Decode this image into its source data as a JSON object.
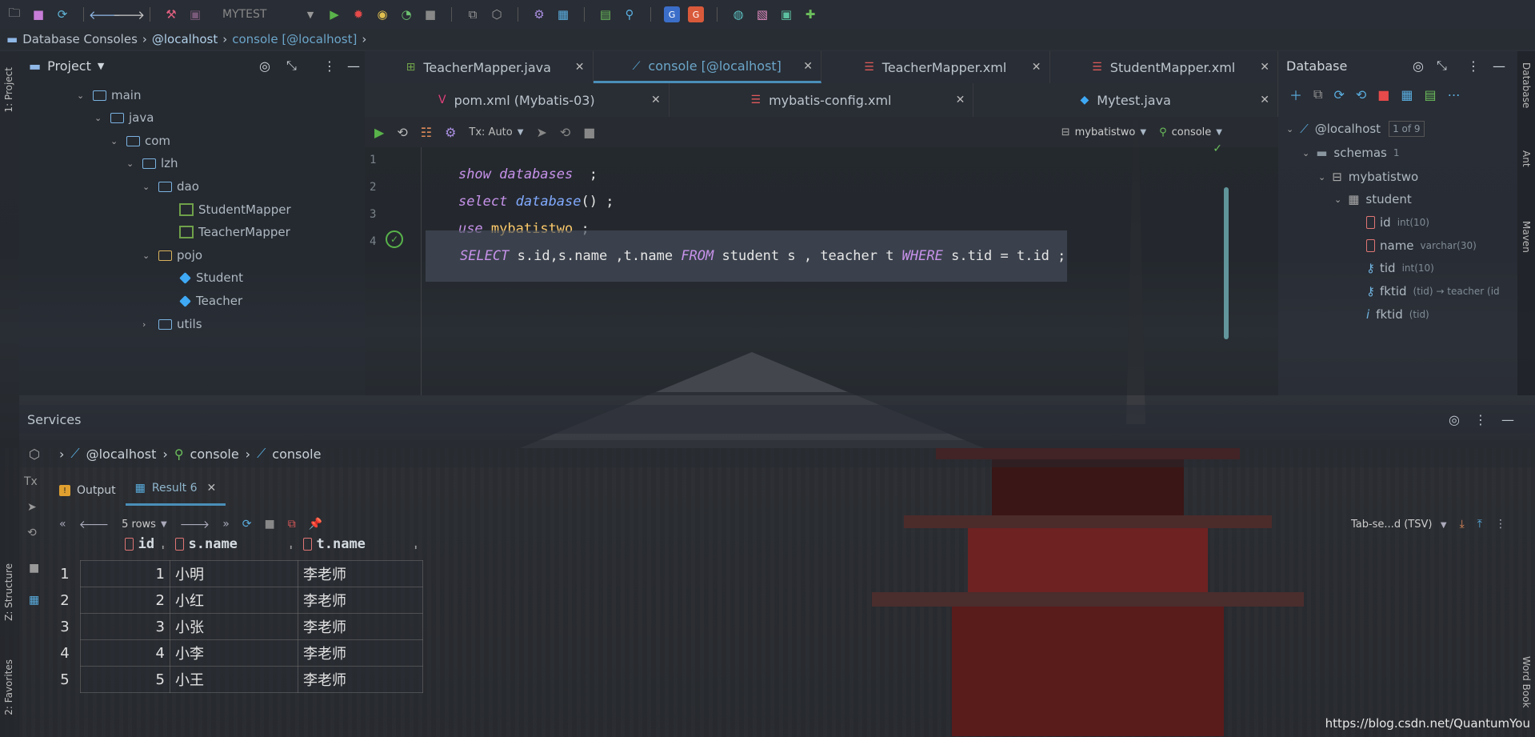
{
  "toolbar": {
    "run_config": "MYTEST"
  },
  "breadcrumb": {
    "root": "Database Consoles",
    "host": "@localhost",
    "console": "console [@localhost]"
  },
  "left_strip": {
    "project": "1: Project",
    "structure": "Z: Structure",
    "favorites": "2: Favorites"
  },
  "project": {
    "title": "Project",
    "tree": [
      {
        "label": "main"
      },
      {
        "label": "java"
      },
      {
        "label": "com"
      },
      {
        "label": "lzh"
      },
      {
        "label": "dao"
      },
      {
        "label": "StudentMapper"
      },
      {
        "label": "TeacherMapper"
      },
      {
        "label": "pojo"
      },
      {
        "label": "Student"
      },
      {
        "label": "Teacher"
      },
      {
        "label": "utils"
      }
    ]
  },
  "editor": {
    "tabs_row1": [
      {
        "label": "TeacherMapper.java"
      },
      {
        "label": "console [@localhost]"
      },
      {
        "label": "TeacherMapper.xml"
      },
      {
        "label": "StudentMapper.xml"
      }
    ],
    "tabs_row2": [
      {
        "label": "pom.xml (Mybatis-03)"
      },
      {
        "label": "mybatis-config.xml"
      },
      {
        "label": "Mytest.java"
      }
    ],
    "tx_mode": "Tx: Auto",
    "schema_selector": "mybatistwo",
    "console_selector": "console",
    "lines": [
      {
        "number": "1"
      },
      {
        "number": "2"
      },
      {
        "number": "3"
      },
      {
        "number": "4"
      }
    ],
    "code": {
      "l1_kw": "show databases",
      "l1_end": "  ;",
      "l2_kw": "select",
      "l2_fn": "database",
      "l2_end": "() ;",
      "l3_kw": "use",
      "l3_ident": "mybatistwo",
      "l3_end": " ;",
      "l4_a": "SELECT",
      "l4_b": " s.id,s.name ,t.name ",
      "l4_c": "FROM",
      "l4_d": " student s , teacher t ",
      "l4_e": "WHERE",
      "l4_f": " s.tid = t.id ;"
    }
  },
  "database": {
    "title": "Database",
    "host": "@localhost",
    "host_badge": "1 of 9",
    "schemas": "schemas",
    "schemas_count": "1",
    "schema": "mybatistwo",
    "table": "student",
    "columns": [
      {
        "name": "id",
        "type": "int(10)"
      },
      {
        "name": "name",
        "type": "varchar(30)"
      },
      {
        "name": "tid",
        "type": "int(10)"
      },
      {
        "name": "fktid",
        "type": "(tid) → teacher (id"
      },
      {
        "name": "fktid",
        "type": "(tid)"
      }
    ],
    "right_strip": {
      "database": "Database",
      "ant": "Ant",
      "maven": "Maven",
      "wordbook": "Word Book"
    }
  },
  "services": {
    "title": "Services",
    "crumb_host": "@localhost",
    "crumb_console1": "console",
    "crumb_console2": "console",
    "tab_output": "Output",
    "tab_result": "Result 6",
    "rows_label": "5 rows",
    "export_format": "Tab-se...d (TSV)",
    "tx_label": "Tx"
  },
  "result_table": {
    "headers": [
      "id",
      "s.name",
      "t.name"
    ],
    "rows": [
      {
        "rn": "1",
        "id": "1",
        "sname": "小明",
        "tname": "李老师"
      },
      {
        "rn": "2",
        "id": "2",
        "sname": "小红",
        "tname": "李老师"
      },
      {
        "rn": "3",
        "id": "3",
        "sname": "小张",
        "tname": "李老师"
      },
      {
        "rn": "4",
        "id": "4",
        "sname": "小李",
        "tname": "李老师"
      },
      {
        "rn": "5",
        "id": "5",
        "sname": "小王",
        "tname": "李老师"
      }
    ]
  },
  "watermark": "https://blog.csdn.net/QuantumYou"
}
